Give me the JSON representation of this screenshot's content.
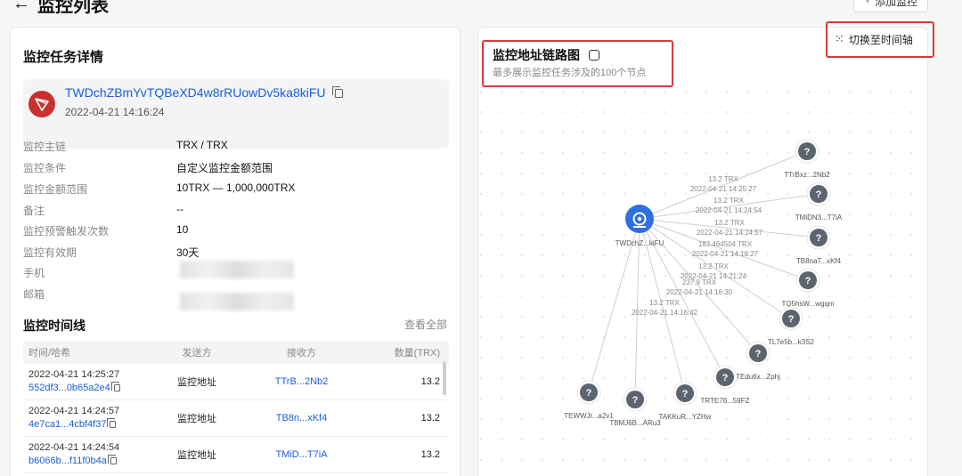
{
  "page": {
    "back_icon": "arrow-left-icon",
    "title": "监控列表",
    "add_button": "添加监控"
  },
  "detail": {
    "title": "监控任务详情",
    "address": "TWDchZBmYvTQBeXD4w8rRUowDv5ka8kiFU",
    "created": "2022-04-21 14:16:24",
    "fields": [
      {
        "label": "监控主链",
        "value": "TRX / TRX"
      },
      {
        "label": "监控条件",
        "value": "自定义监控金额范围"
      },
      {
        "label": "监控金额范围",
        "value": "10TRX — 1,000,000TRX"
      },
      {
        "label": "备注",
        "value": "--"
      },
      {
        "label": "监控预警触发次数",
        "value": "10"
      },
      {
        "label": "监控有效期",
        "value": "30天"
      },
      {
        "label": "手机",
        "value": ""
      },
      {
        "label": "邮箱",
        "value": ""
      }
    ]
  },
  "timeline": {
    "title": "监控时间线",
    "view_all": "查看全部",
    "columns": [
      "时间/哈希",
      "发送方",
      "接收方",
      "数量(TRX)"
    ],
    "rows": [
      {
        "time": "2022-04-21 14:25:27",
        "hash": "552df3...0b65a2e4",
        "from": "监控地址",
        "to": "TTrB...2Nb2",
        "amount": "13.2"
      },
      {
        "time": "2022-04-21 14:24:57",
        "hash": "4e7ca1...4cbf4f37",
        "from": "监控地址",
        "to": "TB8n...xKf4",
        "amount": "13.2"
      },
      {
        "time": "2022-04-21 14:24:54",
        "hash": "b6066b...f11f0b4a",
        "from": "监控地址",
        "to": "TMiD...T7iA",
        "amount": "13.2"
      }
    ]
  },
  "graph": {
    "title": "监控地址链路图",
    "subtitle": "最多展示监控任务涉及的100个节点",
    "switch_label": "切换至时间轴",
    "center_label": "TWDchZ...kiFU",
    "unknown_glyph": "?",
    "nodes": [
      {
        "label": "TTrBxz...2Nb2"
      },
      {
        "label": "TMiDN3...T7iA"
      },
      {
        "label": "TB8naT...xKf4"
      },
      {
        "label": "TQ5hsW...wgqm"
      },
      {
        "label": "TL7e5b...k3S2"
      },
      {
        "label": "TEdu6x...Zphj"
      },
      {
        "label": "TRTE76...59FZ"
      },
      {
        "label": "TAKKuR...YZHw"
      },
      {
        "label": "TBMJ6B...ARu3"
      },
      {
        "label": "TEWWJr...a2v1"
      }
    ],
    "edge_labels": [
      {
        "amount": "13.2 TRX",
        "time": "2022-04-21 14:25:27"
      },
      {
        "amount": "13.2 TRX",
        "time": "2022-04-21 14:24:54"
      },
      {
        "amount": "13.2 TRX",
        "time": "2022-04-21 14:24:57"
      },
      {
        "amount": "183.464504 TRX",
        "time": "2022-04-21 14:18:27"
      },
      {
        "amount": "13.2 TRX",
        "time": "2022-04-21 14:21:24"
      },
      {
        "amount": "237.9 TRX",
        "time": "2022-04-21 14:16:30"
      },
      {
        "amount": "13.2 TRX",
        "time": "2022-04-21 14:16:42"
      }
    ]
  }
}
